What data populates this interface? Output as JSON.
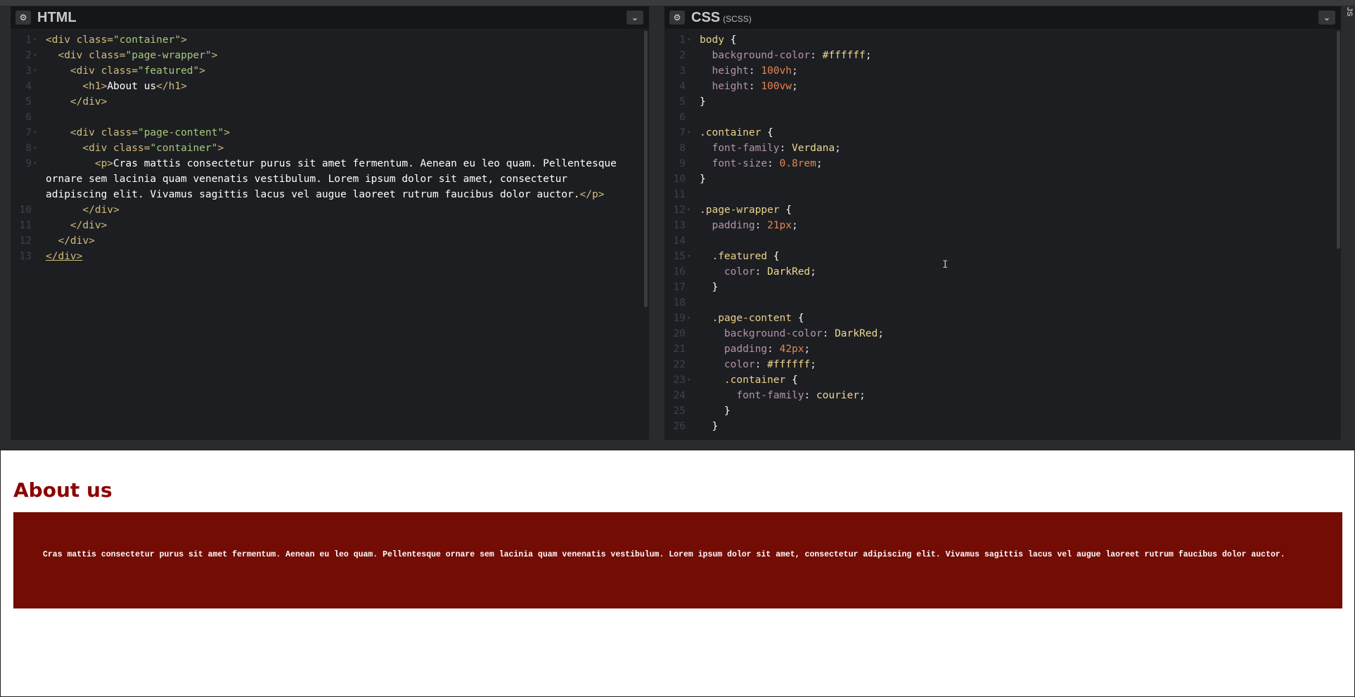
{
  "html_panel": {
    "title": "HTML",
    "line_numbers": [
      "1",
      "2",
      "3",
      "4",
      "5",
      "6",
      "7",
      "8",
      "9",
      "",
      "",
      "10",
      "11",
      "12",
      "13"
    ]
  },
  "css_panel": {
    "title": "CSS",
    "subtitle": "(SCSS)",
    "line_numbers": [
      "1",
      "2",
      "3",
      "4",
      "5",
      "6",
      "7",
      "8",
      "9",
      "10",
      "11",
      "12",
      "13",
      "14",
      "15",
      "16",
      "17",
      "18",
      "19",
      "20",
      "21",
      "22",
      "23",
      "24",
      "25",
      "26"
    ]
  },
  "side_tab": "JS",
  "icons": {
    "gear": "gear-icon",
    "chevron": "chevron-down-icon",
    "cursor": "text-cursor-icon"
  },
  "preview": {
    "heading": "About us",
    "paragraph": "Cras mattis consectetur purus sit amet fermentum. Aenean eu leo quam. Pellentesque ornare sem lacinia quam venenatis vestibulum. Lorem ipsum dolor sit amet, consectetur adipiscing elit. Vivamus sagittis lacus vel augue laoreet rutrum faucibus dolor auctor."
  },
  "colors": {
    "editor_bg": "#1d1e22",
    "dark_red": "#8b0000",
    "content_bg": "#730c04"
  }
}
